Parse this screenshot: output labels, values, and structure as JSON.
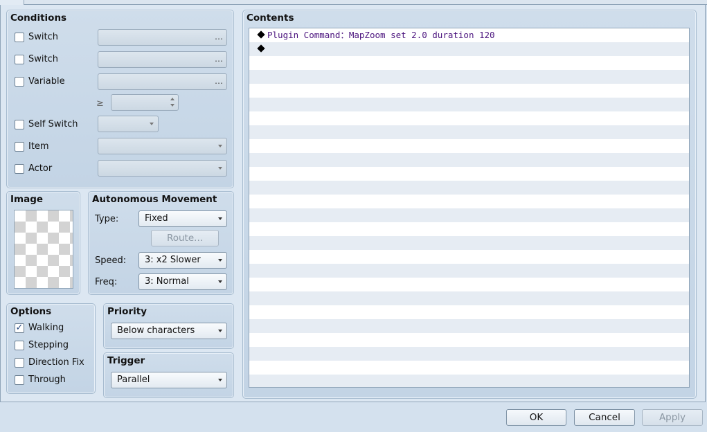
{
  "conditions": {
    "title": "Conditions",
    "switch1": {
      "label": "Switch",
      "checked": false,
      "button": "…"
    },
    "switch2": {
      "label": "Switch",
      "checked": false,
      "button": "…"
    },
    "variable": {
      "label": "Variable",
      "checked": false,
      "button": "…",
      "operator": "≥"
    },
    "self_switch": {
      "label": "Self Switch",
      "checked": false
    },
    "item": {
      "label": "Item",
      "checked": false
    },
    "actor": {
      "label": "Actor",
      "checked": false
    }
  },
  "image": {
    "title": "Image"
  },
  "autonomous_movement": {
    "title": "Autonomous Movement",
    "type_label": "Type:",
    "type_value": "Fixed",
    "route_button": "Route...",
    "speed_label": "Speed:",
    "speed_value": "3: x2 Slower",
    "freq_label": "Freq:",
    "freq_value": "3: Normal"
  },
  "options": {
    "title": "Options",
    "walking": {
      "label": "Walking",
      "checked": true,
      "mark": "✓"
    },
    "stepping": {
      "label": "Stepping",
      "checked": false
    },
    "direction_fix": {
      "label": "Direction Fix",
      "checked": false
    },
    "through": {
      "label": "Through",
      "checked": false
    }
  },
  "priority": {
    "title": "Priority",
    "value": "Below characters"
  },
  "trigger": {
    "title": "Trigger",
    "value": "Parallel"
  },
  "contents": {
    "title": "Contents",
    "commands": [
      {
        "text": "Plugin Command：MapZoom set 2.0 duration 120"
      },
      {
        "text": ""
      }
    ]
  },
  "footer": {
    "ok": "OK",
    "cancel": "Cancel",
    "apply": "Apply"
  },
  "colors": {
    "command_text": "#4b147e",
    "panel": "#c8d8e8",
    "page": "#d4e1ee"
  }
}
